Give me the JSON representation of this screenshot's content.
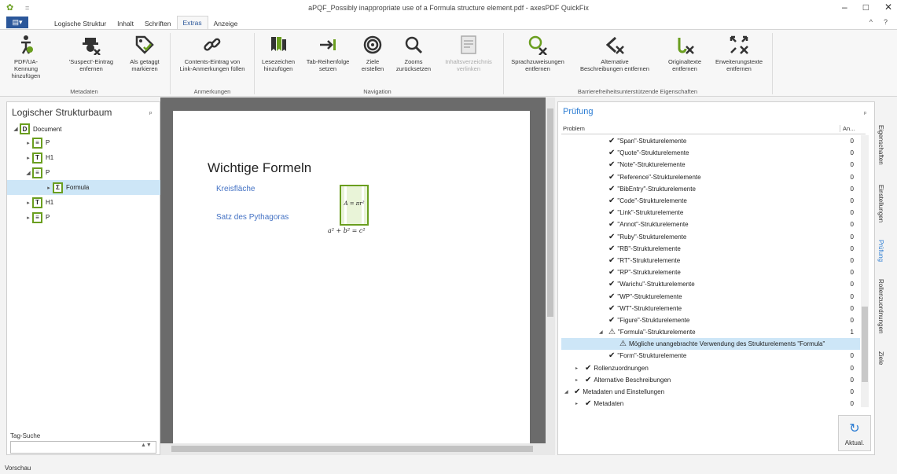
{
  "window": {
    "title": "aPQF_Possibly inappropriate use of a Formula structure element.pdf - axesPDF QuickFix",
    "qa": "=",
    "controls": {
      "minimize": "–",
      "maximize": "□",
      "close": "✕"
    }
  },
  "menu": {
    "file_label": "▤▾",
    "tabs": [
      "Logische Struktur",
      "Inhalt",
      "Schriften",
      "Extras",
      "Anzeige"
    ],
    "active_tab": "Extras",
    "right": {
      "collapse": "^",
      "help": "?"
    }
  },
  "ribbon": {
    "groups": [
      {
        "label": "Metadaten",
        "buttons": [
          {
            "line1": "PDF/UA-Kennung",
            "line2": "hinzufügen",
            "icon": "accessibility-icon"
          },
          {
            "line1": "'Suspect'-Eintrag",
            "line2": "enfernen",
            "icon": "spy-remove-icon"
          },
          {
            "line1": "Als getaggt",
            "line2": "markieren",
            "icon": "tag-check-icon"
          }
        ]
      },
      {
        "label": "Anmerkungen",
        "buttons": [
          {
            "line1": "Contents-Eintrag von",
            "line2": "Link-Anmerkungen füllen",
            "icon": "chain-link-icon"
          }
        ]
      },
      {
        "label": "Navigation",
        "buttons": [
          {
            "line1": "Lesezeichen",
            "line2": "hinzufügen",
            "icon": "bookmarks-icon"
          },
          {
            "line1": "Tab-Reihenfolge",
            "line2": "setzen",
            "icon": "tab-arrow-icon"
          },
          {
            "line1": "Ziele",
            "line2": "erstellen",
            "icon": "target-icon"
          },
          {
            "line1": "Zooms",
            "line2": "zurücksetzen",
            "icon": "zoom-icon"
          },
          {
            "line1": "Inhaltsverzeichnis",
            "line2": "verlinken",
            "icon": "toc-icon",
            "disabled": true
          }
        ]
      },
      {
        "label": "Barrierefreiheitsunterstützende Eigenschaften",
        "buttons": [
          {
            "line1": "Sprachzuweisungen",
            "line2": "entfernen",
            "icon": "speech-remove-icon"
          },
          {
            "line1": "Alternative",
            "line2": "Beschreibungen entfernen",
            "icon": "alt-remove-icon"
          },
          {
            "line1": "Originaltexte",
            "line2": "entfernen",
            "icon": "origtext-remove-icon"
          },
          {
            "line1": "Erweiterungstexte",
            "line2": "entfernen",
            "icon": "expand-remove-icon"
          }
        ]
      }
    ]
  },
  "structure_tree": {
    "title": "Logischer Strukturbaum",
    "pin": "ᵖ",
    "nodes": [
      {
        "label": "Document",
        "arrow": "◢",
        "depth": 0,
        "glyph": "D"
      },
      {
        "label": "P",
        "arrow": "▸",
        "depth": 1,
        "glyph": "≡"
      },
      {
        "label": "H1",
        "arrow": "▸",
        "depth": 1,
        "glyph": "T"
      },
      {
        "label": "P",
        "arrow": "◢",
        "depth": 1,
        "glyph": "≡"
      },
      {
        "label": "Formula",
        "arrow": "▸",
        "depth": 2,
        "glyph": "Σ",
        "selected": true
      },
      {
        "label": "H1",
        "arrow": "▸",
        "depth": 1,
        "glyph": "T"
      },
      {
        "label": "P",
        "arrow": "▸",
        "depth": 1,
        "glyph": "≡"
      }
    ],
    "tag_search_label": "Tag-Suche",
    "tag_search_value": ""
  },
  "document": {
    "heading": "Wichtige Formeln",
    "link1": "Kreisfläche",
    "link2": "Satz des Pythagoras",
    "formula_in_box": "A = πr²",
    "formula_below": "a² + b² = c²"
  },
  "check_panel": {
    "title": "Prüfung",
    "col_problem": "Problem",
    "col_count": "An...",
    "rows": [
      {
        "label": "\"Span\"-Strukturelemente",
        "count": "0",
        "indent": 60,
        "icon": "check"
      },
      {
        "label": "\"Quote\"-Strukturelemente",
        "count": "0",
        "indent": 60,
        "icon": "check"
      },
      {
        "label": "\"Note\"-Strukturelemente",
        "count": "0",
        "indent": 60,
        "icon": "check"
      },
      {
        "label": "\"Reference\"-Strukturelemente",
        "count": "0",
        "indent": 60,
        "icon": "check"
      },
      {
        "label": "\"BibEntry\"-Strukturelemente",
        "count": "0",
        "indent": 60,
        "icon": "check"
      },
      {
        "label": "\"Code\"-Strukturelemente",
        "count": "0",
        "indent": 60,
        "icon": "check"
      },
      {
        "label": "\"Link\"-Strukturelemente",
        "count": "0",
        "indent": 60,
        "icon": "check"
      },
      {
        "label": "\"Annot\"-Strukturelemente",
        "count": "0",
        "indent": 60,
        "icon": "check"
      },
      {
        "label": "\"Ruby\"-Strukturelemente",
        "count": "0",
        "indent": 60,
        "icon": "check"
      },
      {
        "label": "\"RB\"-Strukturelemente",
        "count": "0",
        "indent": 60,
        "icon": "check"
      },
      {
        "label": "\"RT\"-Strukturelemente",
        "count": "0",
        "indent": 60,
        "icon": "check"
      },
      {
        "label": "\"RP\"-Strukturelemente",
        "count": "0",
        "indent": 60,
        "icon": "check"
      },
      {
        "label": "\"Warichu\"-Strukturelemente",
        "count": "0",
        "indent": 60,
        "icon": "check"
      },
      {
        "label": "\"WP\"-Strukturelemente",
        "count": "0",
        "indent": 60,
        "icon": "check"
      },
      {
        "label": "\"WT\"-Strukturelemente",
        "count": "0",
        "indent": 60,
        "icon": "check"
      },
      {
        "label": "\"Figure\"-Strukturelemente",
        "count": "0",
        "indent": 60,
        "icon": "check"
      },
      {
        "label": "\"Formula\"-Strukturelemente",
        "count": "1",
        "indent": 60,
        "icon": "warn",
        "tri": "◢"
      },
      {
        "label": "Mögliche unangebrachte Verwendung des Strukturelements \"Formula\"",
        "count": "",
        "indent": 74,
        "icon": "warn",
        "selected": true
      },
      {
        "label": "\"Form\"-Strukturelemente",
        "count": "0",
        "indent": 60,
        "icon": "check"
      },
      {
        "label": "Rollenzuordnungen",
        "count": "0",
        "indent": 30,
        "icon": "check",
        "tri": "▸"
      },
      {
        "label": "Alternative Beschreibungen",
        "count": "0",
        "indent": 30,
        "icon": "check",
        "tri": "▸"
      },
      {
        "label": "Metadaten und Einstellungen",
        "count": "0",
        "indent": 16,
        "icon": "check",
        "tri": "◢"
      },
      {
        "label": "Metadaten",
        "count": "0",
        "indent": 30,
        "icon": "check",
        "tri": "▸"
      }
    ],
    "refresh_label": "Aktual."
  },
  "side_tabs": [
    "Eigenschaften",
    "Einstellungen",
    "Prüfung",
    "Rollenzuordnungen",
    "Ziele"
  ],
  "active_side_tab": "Prüfung",
  "status": "Vorschau",
  "colors": {
    "accent": "#2b7cd3",
    "brand_green": "#6a9e1f",
    "file_tab": "#2b579a",
    "selection": "#cde6f7"
  }
}
